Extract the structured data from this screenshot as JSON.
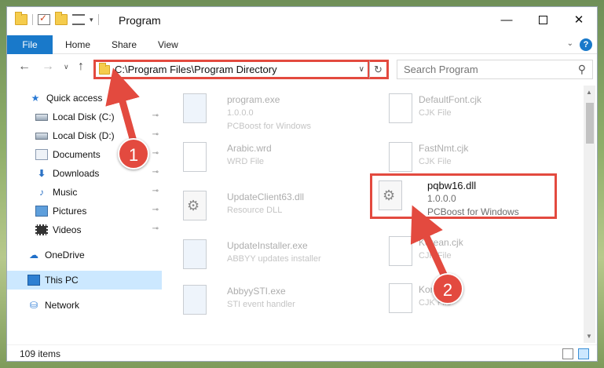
{
  "window": {
    "title": "Program",
    "controls": {
      "minimize": "—",
      "close": "✕"
    }
  },
  "qat": {
    "dropdown": "▾"
  },
  "ribbon": {
    "tabs": [
      "File",
      "Home",
      "Share",
      "View"
    ],
    "expand": "⌄",
    "help": "?"
  },
  "nav": {
    "back": "←",
    "forward": "→",
    "recent": "∨",
    "up": "↑"
  },
  "address": {
    "path": "C:\\Program Files\\Program Directory",
    "dropdown": "∨",
    "refresh": "↻"
  },
  "search": {
    "placeholder": "Search Program",
    "icon": "search-icon"
  },
  "sidebar": {
    "items": [
      {
        "label": "Quick access",
        "icon": "star-icon"
      },
      {
        "label": "Local Disk (C:)",
        "icon": "disk-icon",
        "pinned": true
      },
      {
        "label": "Local Disk (D:)",
        "icon": "disk-icon",
        "pinned": true
      },
      {
        "label": "Documents",
        "icon": "documents-icon",
        "pinned": true
      },
      {
        "label": "Downloads",
        "icon": "downloads-icon",
        "pinned": true
      },
      {
        "label": "Music",
        "icon": "music-icon",
        "pinned": true
      },
      {
        "label": "Pictures",
        "icon": "pictures-icon",
        "pinned": true
      },
      {
        "label": "Videos",
        "icon": "videos-icon",
        "pinned": true
      },
      {
        "label": "OneDrive",
        "icon": "onedrive-icon"
      },
      {
        "label": "This PC",
        "icon": "this-pc-icon",
        "selected": true
      },
      {
        "label": "Network",
        "icon": "network-icon"
      }
    ],
    "pin_glyph": "📌"
  },
  "files": {
    "left": [
      {
        "name": "program.exe",
        "line2": "1.0.0.0",
        "line3": "PCBoost for Windows"
      },
      {
        "name": "Arabic.wrd",
        "line2": "WRD File"
      },
      {
        "name": "UpdateClient63.dll",
        "line2": "Resource DLL"
      },
      {
        "name": "UpdateInstaller.exe",
        "line2": "ABBYY updates installer"
      },
      {
        "name": "AbbyySTI.exe",
        "line2": "STI event handler"
      }
    ],
    "right": [
      {
        "name": "DefaultFont.cjk",
        "line2": "CJK File"
      },
      {
        "name": "FastNmt.cjk",
        "line2": "CJK File"
      },
      {
        "name": "Korean.cjk",
        "line2": "CJK File"
      },
      {
        "name": "Korean.cjk",
        "line2": "CJK File"
      }
    ],
    "highlighted": {
      "name": "pqbw16.dll",
      "version": "1.0.0.0",
      "company": "PCBoost for Windows"
    }
  },
  "status": {
    "count": "109 items"
  },
  "annotations": {
    "step1": "1",
    "step2": "2",
    "color": "#e34a3f"
  }
}
